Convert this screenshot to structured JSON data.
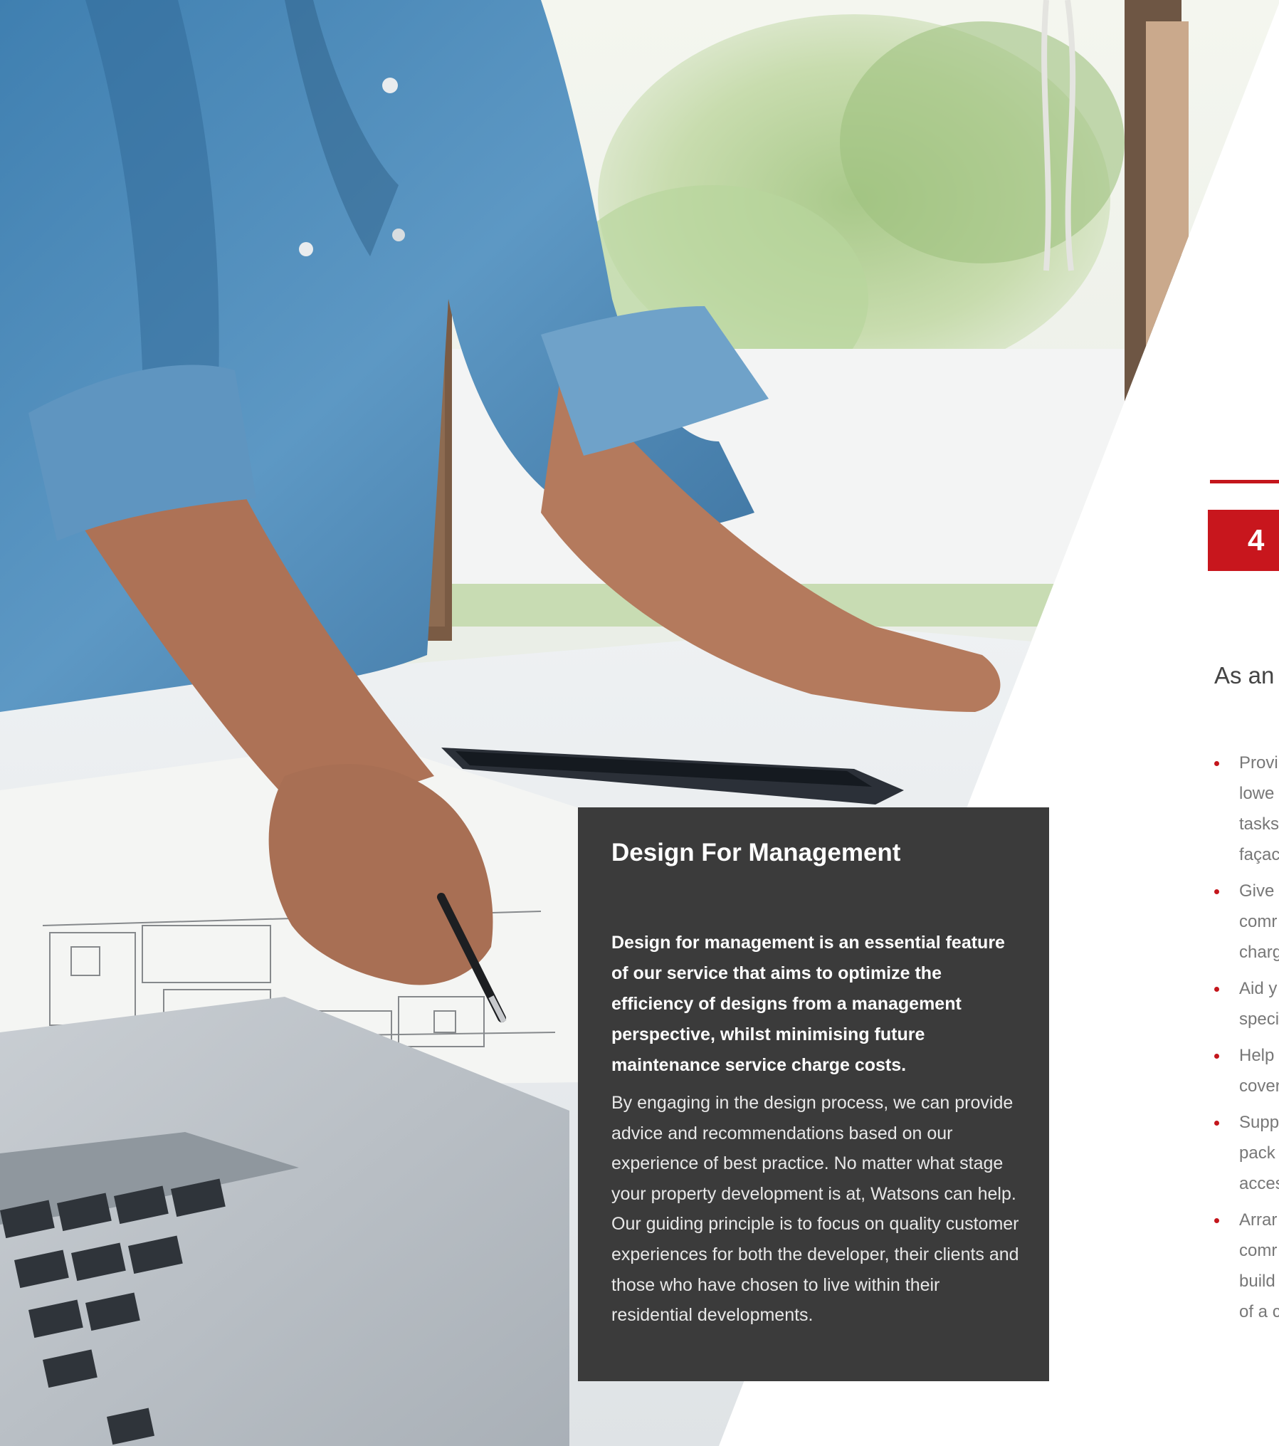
{
  "image": {
    "alt": "Person leaning over a desk reviewing architectural plans with a pen, next to a laptop and tablet",
    "icon": "photo"
  },
  "section": {
    "number": "4"
  },
  "intro_text": "As an",
  "bullets": [
    {
      "lines": [
        "Provi",
        "lowe",
        "tasks",
        "façac"
      ]
    },
    {
      "lines": [
        "Give",
        "comr",
        "charg"
      ]
    },
    {
      "lines": [
        "Aid y",
        "speci"
      ]
    },
    {
      "lines": [
        "Help",
        "cover"
      ]
    },
    {
      "lines": [
        "Supp",
        "pack",
        "acces"
      ]
    },
    {
      "lines": [
        "Arrar",
        "comr",
        "build",
        "of a c"
      ]
    }
  ],
  "panel": {
    "title": "Design For Management",
    "lead": "Design for management is an essential feature of our service that aims to optimize the efficiency of designs from a management perspective, whilst minimising future maintenance service charge costs.",
    "body": "By engaging in the design process, we can provide advice and recommendations based on our experience of best practice. No matter what stage your property development is at, Watsons can help. Our guiding principle is to focus on quality customer experiences for both the developer, their clients and those who have chosen to live within their residential developments."
  },
  "colors": {
    "accent": "#c4161c",
    "panel": "#3b3b3b"
  }
}
